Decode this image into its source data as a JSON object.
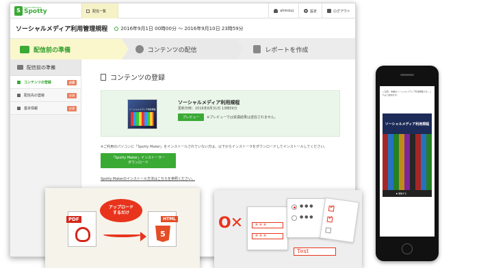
{
  "app": {
    "logo_sub": "GOOGLEBOOKS",
    "logo_name": "Spotty",
    "nav_tab": "配信一覧",
    "user_label": "ahmizuj",
    "settings_label": "設定",
    "logout_label": "ログアウト"
  },
  "page": {
    "title": "ソーシャルメディア利用管理規程",
    "period": "2016年9月1日 00時00分 ～ 2016年9月10日 23時59分"
  },
  "steps": [
    {
      "label": "配信前の準備",
      "active": true
    },
    {
      "label": "コンテンツの配信",
      "active": false
    },
    {
      "label": "レポートを作成",
      "active": false
    }
  ],
  "sidebar": {
    "header": "配信前の準備",
    "items": [
      {
        "label": "コンテンツの登録",
        "badge": "必須",
        "active": true
      },
      {
        "label": "配信先の登録",
        "badge": "必須",
        "active": false
      },
      {
        "label": "基本情報",
        "badge": "必須",
        "active": false
      }
    ]
  },
  "content": {
    "section_title": "コンテンツの登録",
    "card_title": "ソーシャルメディア利用規程",
    "updated": "更新日時：2016年8月31日 13時59分",
    "thumb_caption": "ソーシャルメディア利用規程",
    "preview_button": "プレビュー",
    "preview_note": "※プレビューでは受講結果は送信されません。",
    "notice": "※ご利用のパソコンに「Spotty Maker」をインストールされていない方は、以下からインストーラをダウンロードしてインストールしてください。",
    "download_line1": "「Spotty Maker」インストーラー",
    "download_line2": "ダウンロード",
    "howto_link": "Spotty Makerのインストール方法はこちらを参照ください。"
  },
  "panel1": {
    "pdf_label": "PDF",
    "html_label": "HTML",
    "html_badge": "5",
    "bubble_line1": "アップロード",
    "bubble_line2": "するだけ"
  },
  "panel2": {
    "ox": "O✕",
    "field1": "＊＊＊",
    "field2": "＊＊＊",
    "dots1": "● ● ●",
    "dots2": "● ● ●",
    "text_box": "Text"
  },
  "phone": {
    "body_text": "ご注意：本書はソーシャルメディア利用規程です。これより始めます。",
    "title": "ソーシャルメディア利用規程",
    "button": "▶ 開始する"
  }
}
